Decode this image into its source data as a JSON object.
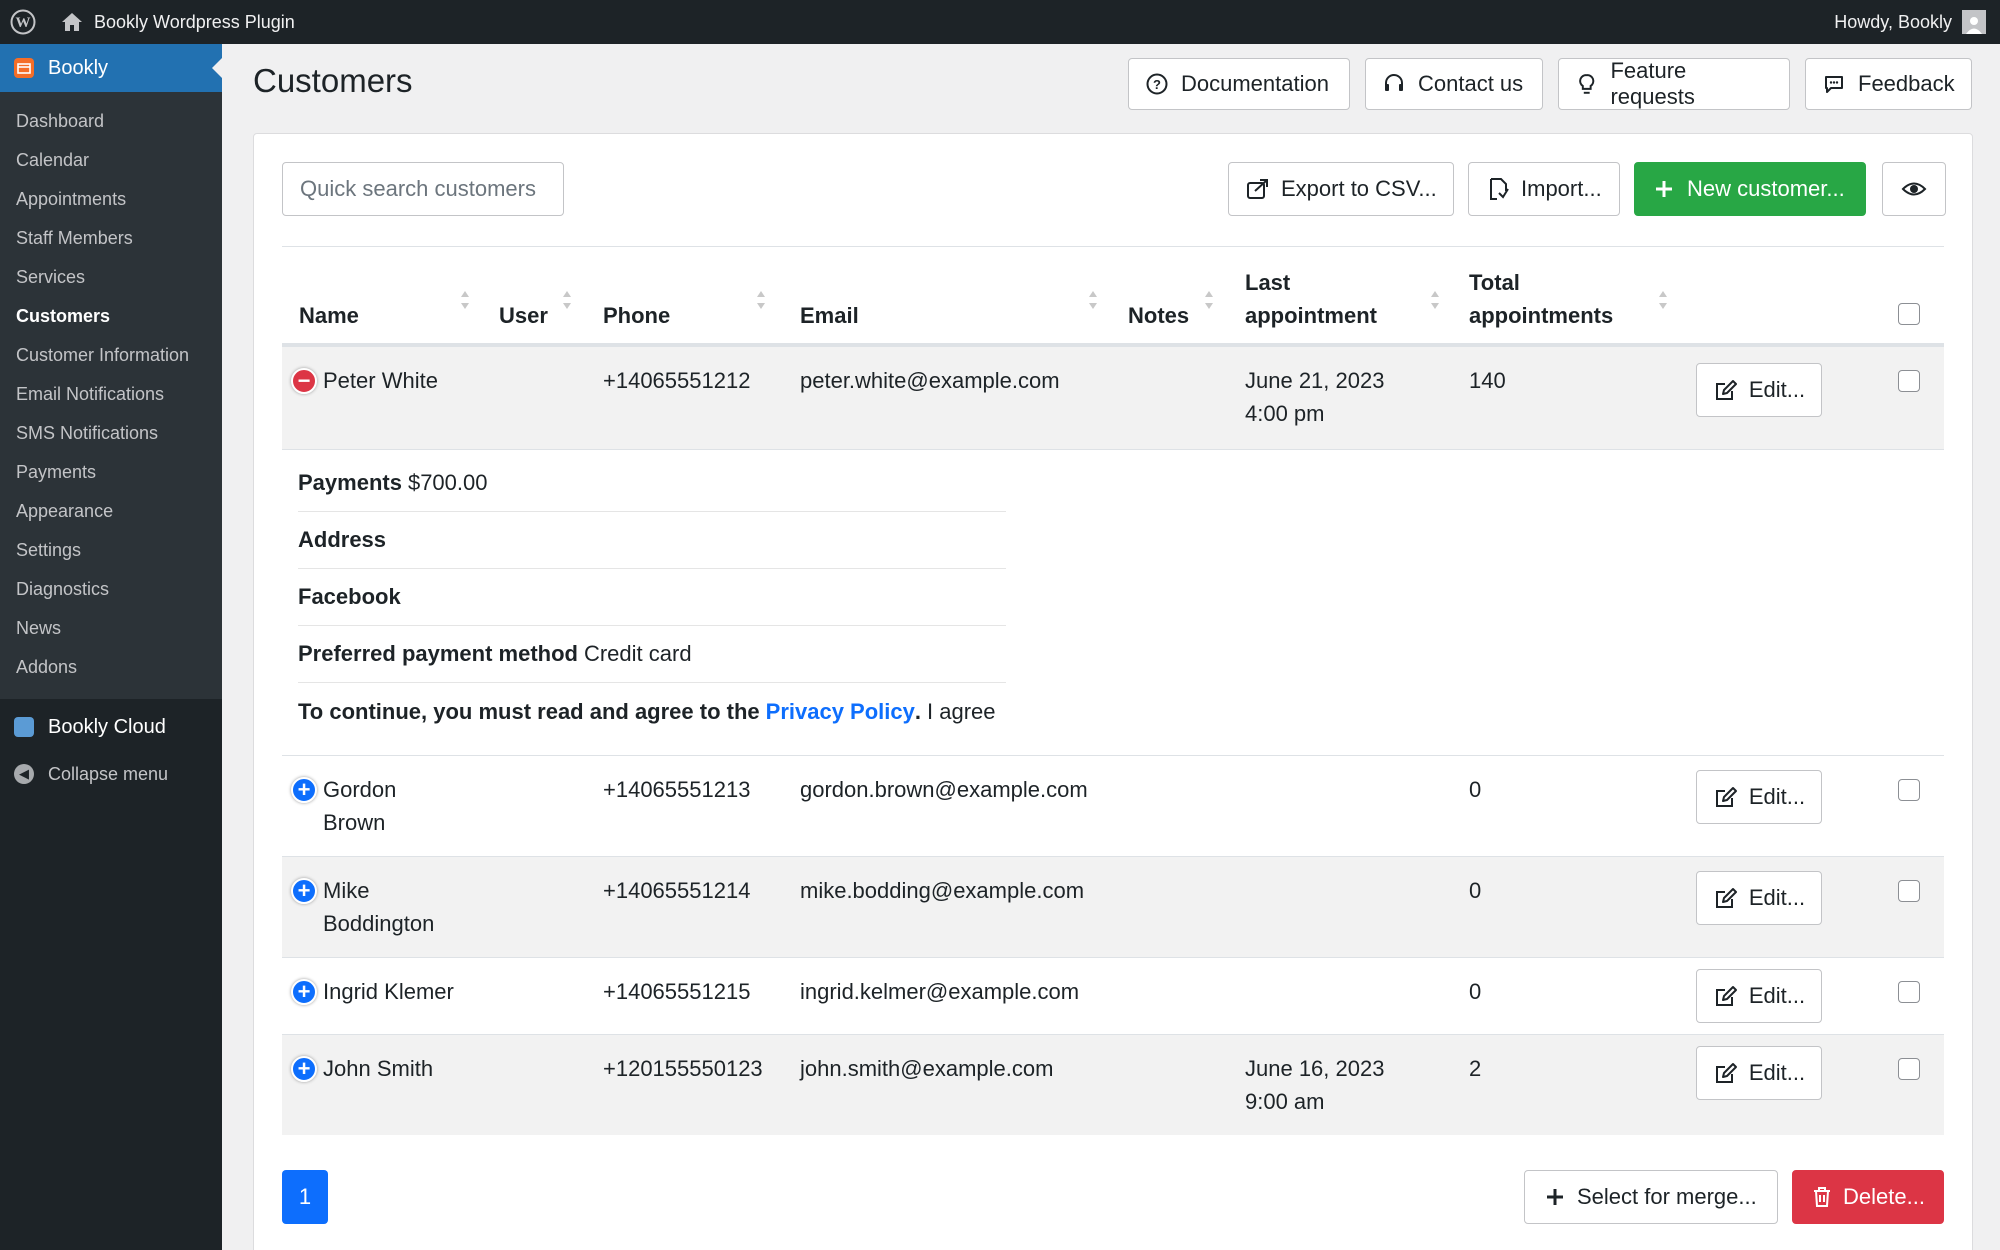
{
  "adminbar": {
    "site_name": "Bookly Wordpress Plugin",
    "howdy": "Howdy, Bookly"
  },
  "sidebar": {
    "top_label": "Bookly",
    "items": [
      {
        "label": "Dashboard"
      },
      {
        "label": "Calendar"
      },
      {
        "label": "Appointments"
      },
      {
        "label": "Staff Members"
      },
      {
        "label": "Services"
      },
      {
        "label": "Customers"
      },
      {
        "label": "Customer Information"
      },
      {
        "label": "Email Notifications"
      },
      {
        "label": "SMS Notifications"
      },
      {
        "label": "Payments"
      },
      {
        "label": "Appearance"
      },
      {
        "label": "Settings"
      },
      {
        "label": "Diagnostics"
      },
      {
        "label": "News"
      },
      {
        "label": "Addons"
      }
    ],
    "active_item": "Customers",
    "cloud_label": "Bookly Cloud",
    "collapse_label": "Collapse menu"
  },
  "page": {
    "title": "Customers"
  },
  "header_buttons": {
    "documentation": "Documentation",
    "contact": "Contact us",
    "feature_requests": "Feature requests",
    "feedback": "Feedback"
  },
  "toolbar": {
    "search_placeholder": "Quick search customers",
    "export": "Export to CSV...",
    "import": "Import...",
    "new_customer": "New customer..."
  },
  "table": {
    "columns": {
      "name": "Name",
      "user": "User",
      "phone": "Phone",
      "email": "Email",
      "notes": "Notes",
      "last_appointment_1": "Last",
      "last_appointment_2": "appointment",
      "total_appointments_1": "Total",
      "total_appointments_2": "appointments"
    },
    "edit_label": "Edit...",
    "rows": [
      {
        "name_1": "Peter White",
        "name_2": "",
        "phone": "+14065551212",
        "email": "peter.white@example.com",
        "last_1": "June 21, 2023",
        "last_2": "4:00 pm",
        "total": "140",
        "expanded": true
      },
      {
        "name_1": "Gordon",
        "name_2": "Brown",
        "phone": "+14065551213",
        "email": "gordon.brown@example.com",
        "last_1": "",
        "last_2": "",
        "total": "0",
        "expanded": false
      },
      {
        "name_1": "Mike",
        "name_2": "Boddington",
        "phone": "+14065551214",
        "email": "mike.bodding@example.com",
        "last_1": "",
        "last_2": "",
        "total": "0",
        "expanded": false
      },
      {
        "name_1": "Ingrid Klemer",
        "name_2": "",
        "phone": "+14065551215",
        "email": "ingrid.kelmer@example.com",
        "last_1": "",
        "last_2": "",
        "total": "0",
        "expanded": false
      },
      {
        "name_1": "John Smith",
        "name_2": "",
        "phone": "+120155550123",
        "email": "john.smith@example.com",
        "last_1": "June 16, 2023",
        "last_2": "9:00 am",
        "total": "2",
        "expanded": false
      }
    ],
    "details": {
      "payments_label": "Payments",
      "payments_value": "$700.00",
      "address_label": "Address",
      "facebook_label": "Facebook",
      "preferred_label": "Preferred payment method",
      "preferred_value": "Credit card",
      "privacy_prefix": "To continue, you must read and agree to the",
      "privacy_link": "Privacy Policy",
      "privacy_suffix": ".",
      "privacy_value": "I agree"
    }
  },
  "footer": {
    "page": "1",
    "merge": "Select for merge...",
    "delete": "Delete..."
  },
  "colors": {
    "primary": "#0d6efd",
    "success": "#28a745",
    "danger": "#dc3545",
    "wp_dark": "#1d2327",
    "wp_blue": "#2271b1"
  }
}
